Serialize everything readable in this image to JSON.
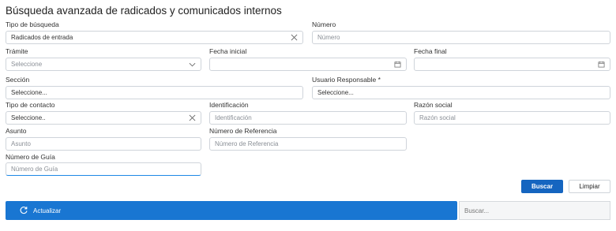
{
  "title": "Búsqueda avanzada de radicados y comunicados internos",
  "form": {
    "tipo_busqueda": {
      "label": "Tipo de búsqueda",
      "value": "Radicados de entrada"
    },
    "numero": {
      "label": "Número",
      "placeholder": "Número"
    },
    "tramite": {
      "label": "Trámite",
      "placeholder": "Seleccione"
    },
    "fecha_inicial": {
      "label": "Fecha inicial",
      "value": ""
    },
    "fecha_final": {
      "label": "Fecha final",
      "value": ""
    },
    "seccion": {
      "label": "Sección",
      "value": "Seleccione..."
    },
    "usuario_responsable": {
      "label": "Usuario Responsable *",
      "value": "Seleccione..."
    },
    "tipo_contacto": {
      "label": "Tipo de contacto",
      "value": "Seleccione.."
    },
    "identificacion": {
      "label": "Identificación",
      "placeholder": "Identificación"
    },
    "razon_social": {
      "label": "Razón social",
      "placeholder": "Razón social"
    },
    "asunto": {
      "label": "Asunto",
      "placeholder": "Asunto"
    },
    "numero_referencia": {
      "label": "Número de Referencia",
      "placeholder": "Número de Referencia"
    },
    "numero_guia": {
      "label": "Número de Guía",
      "placeholder": "Número de Guía"
    }
  },
  "buttons": {
    "buscar": "Buscar",
    "limpiar": "Limpiar",
    "actualizar": "Actualizar"
  },
  "table_search": {
    "placeholder": "Buscar..."
  },
  "colors": {
    "primary": "#1565c0",
    "bar": "#1976d2",
    "border": "#cfd4da"
  }
}
